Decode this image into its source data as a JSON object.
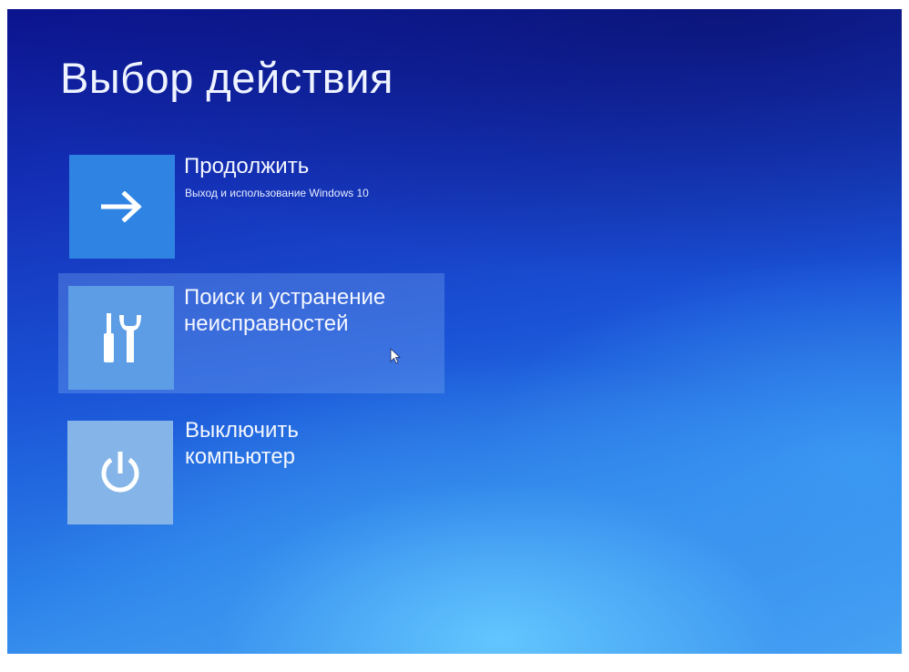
{
  "screen": {
    "title": "Выбор действия"
  },
  "options": [
    {
      "id": "continue",
      "label": "Продолжить",
      "description": "Выход и использование Windows 10",
      "icon": "arrow-right-icon"
    },
    {
      "id": "troubleshoot",
      "label_line1": "Поиск и устранение",
      "label_line2": "неисправностей",
      "icon": "tools-icon",
      "highlighted": true
    },
    {
      "id": "shutdown",
      "label_line1": "Выключить",
      "label_line2": "компьютер",
      "icon": "power-icon"
    }
  ],
  "colors": {
    "background_top": "#0c148f",
    "background_bottom": "#4aa7f4",
    "tile_continue": "#2f84e3",
    "tile_troubleshoot": "#5d9de6",
    "tile_shutdown": "#85b5e8",
    "text": "#f4f7ff"
  }
}
